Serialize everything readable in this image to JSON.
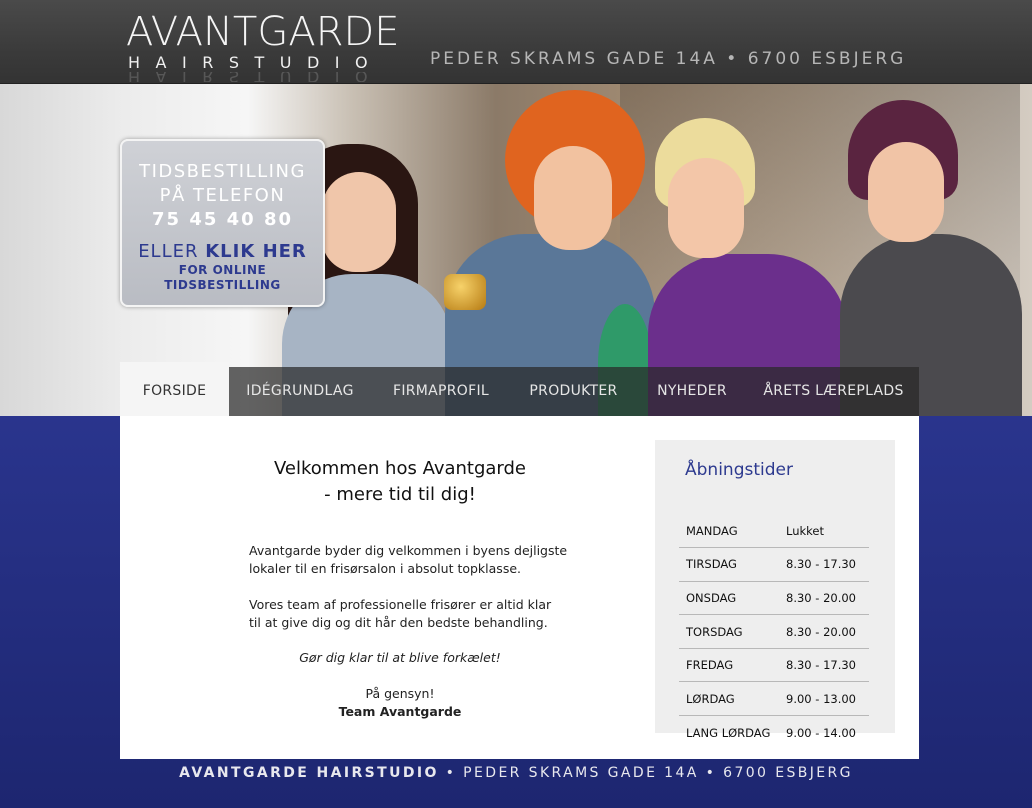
{
  "logo": {
    "main": "AVANTGARDE",
    "sub": "HAIRSTUDIO"
  },
  "header": {
    "address": "PEDER SKRAMS GADE 14A • 6700 ESBJERG"
  },
  "booking": {
    "line1": "TIDSBESTILLING",
    "line2": "PÅ TELEFON",
    "phone": "75 45 40 80",
    "eller": "ELLER",
    "klik": "KLIK HER",
    "online1": "FOR ONLINE",
    "online2": "TIDSBESTILLING"
  },
  "nav": {
    "items": [
      {
        "label": "FORSIDE"
      },
      {
        "label": "IDÉGRUNDLAG"
      },
      {
        "label": "FIRMAPROFIL"
      },
      {
        "label": "PRODUKTER"
      },
      {
        "label": "NYHEDER"
      },
      {
        "label": "ÅRETS LÆREPLADS"
      }
    ]
  },
  "welcome": {
    "title1": "Velkommen hos Avantgarde",
    "title2": "- mere tid til dig!",
    "para1a": "Avantgarde byder dig velkommen i byens dejligste",
    "para1b": "lokaler til en frisørsalon i absolut topklasse.",
    "para2a": "Vores team af professionelle frisører er altid klar",
    "para2b": "til at give dig og dit hår den bedste behandling.",
    "tagline": "Gør dig klar til at blive forkælet!",
    "greeting": "På gensyn!",
    "signature": "Team Avantgarde"
  },
  "hours": {
    "title": "Åbningstider",
    "rows": [
      {
        "day": "MANDAG",
        "time": "Lukket"
      },
      {
        "day": "TIRSDAG",
        "time": "8.30 - 17.30"
      },
      {
        "day": "ONSDAG",
        "time": "8.30 - 20.00"
      },
      {
        "day": "TORSDAG",
        "time": "8.30 - 20.00"
      },
      {
        "day": "FREDAG",
        "time": "8.30 - 17.30"
      },
      {
        "day": "LØRDAG",
        "time": "9.00 - 13.00"
      },
      {
        "day": "LANG LØRDAG",
        "time": "9.00 - 14.00"
      }
    ]
  },
  "footer": {
    "brand": "AVANTGARDE HAIRSTUDIO",
    "address": " • PEDER SKRAMS GADE 14A • 6700 ESBJERG"
  }
}
